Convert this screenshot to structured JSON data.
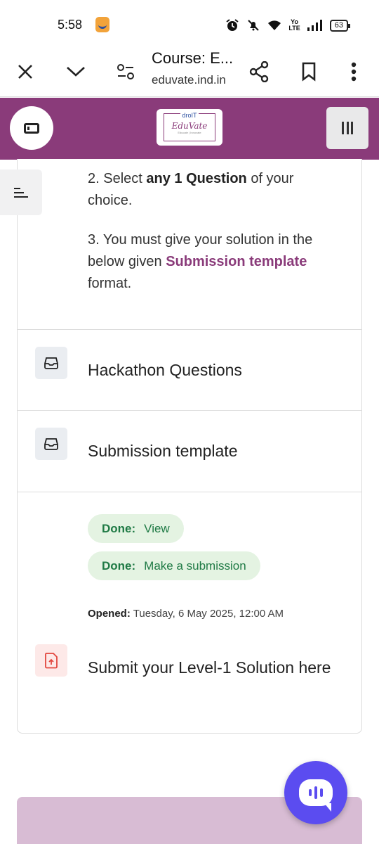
{
  "status_bar": {
    "time": "5:58",
    "lte_top": "Yo",
    "lte_bottom": "LTE",
    "battery": "63"
  },
  "browser": {
    "page_title": "Course: E...",
    "host": "eduvate.ind.in"
  },
  "header": {
    "logo_top": "droIT",
    "logo_main": "EduVate",
    "logo_tag": "Educate | Innovate"
  },
  "content": {
    "step2": {
      "prefix": "2. Select ",
      "bold": "any 1 Question",
      "suffix": " of your choice."
    },
    "step3": {
      "prefix": "3. You must give your solution in the below given ",
      "link": "Submission template",
      "suffix": " format."
    },
    "activities": [
      {
        "title": "Hackathon Questions",
        "icon": "folder-icon"
      },
      {
        "title": "Submission template",
        "icon": "folder-icon"
      }
    ],
    "assignment": {
      "done1_label": "Done:",
      "done1_value": "View",
      "done2_label": "Done:",
      "done2_value": "Make a submission",
      "opened_label": "Opened:",
      "opened_value": "Tuesday, 6 May 2025, 12:00 AM",
      "title": "Submit your Level-1 Solution here",
      "icon": "assignment-upload-icon"
    }
  },
  "colors": {
    "brand": "#8a3b7a",
    "done_bg": "#e4f3e2",
    "done_text": "#1f7a45",
    "chat": "#5b4cf0"
  }
}
